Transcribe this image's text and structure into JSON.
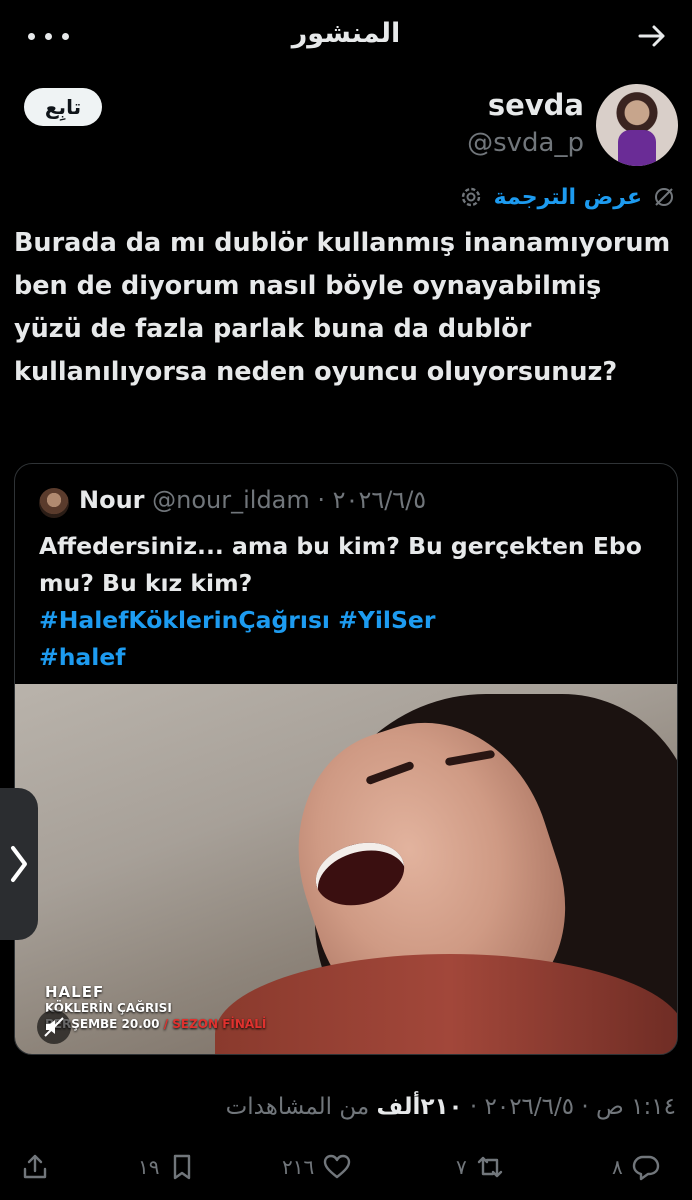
{
  "header": {
    "title": "المنشور"
  },
  "author": {
    "name": "sevda",
    "handle": "@svda_p",
    "follow_label": "تابِع"
  },
  "translate": {
    "label": "عرض الترجمة"
  },
  "post": {
    "text": "Burada da mı dublör kullanmış inanamıyorum ben de diyorum nasıl böyle oynayabilmiş yüzü de fazla parlak buna da dublör kullanılıyorsa neden oyuncu oluyorsunuz?"
  },
  "quote": {
    "name": "Nour",
    "meta": " @nour_ildam · ٢٠٢٦/٦/٥",
    "text": "Affedersiniz... ama bu kim? Bu gerçekten Ebo mu? Bu kız kim?",
    "hashtags_line1": "#HalefKöklerinÇağrısı #YilSer",
    "hashtags_line2": "#halef",
    "media": {
      "logo_line1": "HALEF",
      "logo_line2": "KÖKLERİN ÇAĞRISI",
      "logo_line3a": "PERŞEMBE 20.00",
      "logo_line3b": "/ SEZON FİNALİ"
    }
  },
  "timestamp": {
    "date_time": "١:١٤ ص · ٢٠٢٦/٦/٥ · ",
    "views_count": "٢١٠ألف",
    "views_label": " من المشاهدات"
  },
  "actions": {
    "replies": "٨",
    "reposts": "٧",
    "likes": "٢١٦",
    "bookmarks": "١٩"
  },
  "icons": {
    "back": "arrow-right-icon",
    "more": "more-dots-icon",
    "settings": "gear-icon",
    "translate": "translate-off-icon",
    "reply": "reply-icon",
    "repost": "repost-icon",
    "like": "heart-icon",
    "bookmark": "bookmark-icon",
    "share": "share-icon",
    "mute": "mute-icon",
    "chevron": "chevron-right-icon"
  },
  "colors": {
    "accent": "#1d9bf0",
    "muted": "#71767b",
    "text": "#e7e9ea",
    "background": "#000000"
  }
}
